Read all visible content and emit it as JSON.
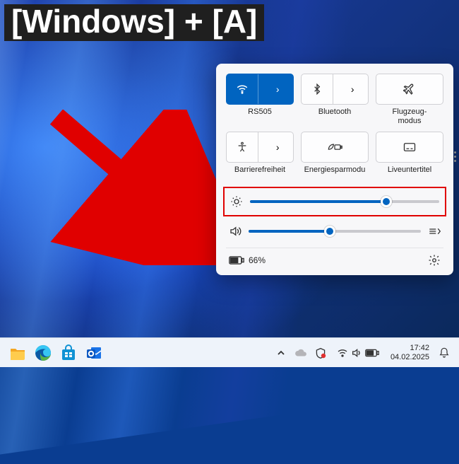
{
  "overlay": {
    "hotkey_text": "[Windows] + [A]"
  },
  "panel": {
    "tiles": [
      {
        "id": "wifi",
        "label": "RS505",
        "active": true,
        "split": true,
        "icon": "wifi-icon"
      },
      {
        "id": "bluetooth",
        "label": "Bluetooth",
        "active": false,
        "split": true,
        "icon": "bluetooth-icon"
      },
      {
        "id": "airplane",
        "label": "Flugzeug-\nmodus",
        "active": false,
        "split": false,
        "icon": "airplane-icon"
      },
      {
        "id": "accessibility",
        "label": "Barrierefreiheit",
        "active": false,
        "split": true,
        "icon": "accessibility-icon"
      },
      {
        "id": "battery-saver",
        "label": "Energiesparmodu",
        "active": false,
        "split": false,
        "icon": "leaf-battery-icon"
      },
      {
        "id": "live-captions",
        "label": "Liveuntertitel",
        "active": false,
        "split": false,
        "icon": "captions-icon"
      }
    ],
    "brightness": {
      "percent": 72
    },
    "volume": {
      "percent": 47
    },
    "battery": {
      "text": "66%"
    }
  },
  "taskbar": {
    "clock": {
      "time": "17:42",
      "date": "04.02.2025"
    }
  },
  "colors": {
    "accent": "#0164c0",
    "highlight_box": "#e00000"
  }
}
